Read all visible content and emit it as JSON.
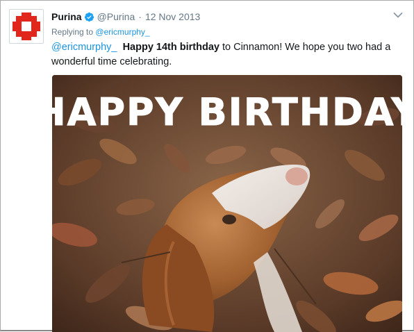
{
  "tweet": {
    "display_name": "Purina",
    "handle": "@Purina",
    "separator": "·",
    "date": "12 Nov 2013",
    "replying_prefix": "Replying to",
    "replying_to": "@ericmurphy_",
    "text": {
      "mention": "@ericmurphy_",
      "bold": "Happy 14th birthday",
      "part1": " to Cinnamon! We hope you two had a wonderful time celebrating."
    },
    "media_caption": "HAPPY BIRTHDAY"
  },
  "icons": {
    "avatar": "purina-checkerboard-logo",
    "verified": "verified-badge-icon",
    "caret": "chevron-down-icon"
  },
  "colors": {
    "brand_red": "#e1261c",
    "link_blue": "#1b95e0",
    "secondary_text": "#657786"
  }
}
